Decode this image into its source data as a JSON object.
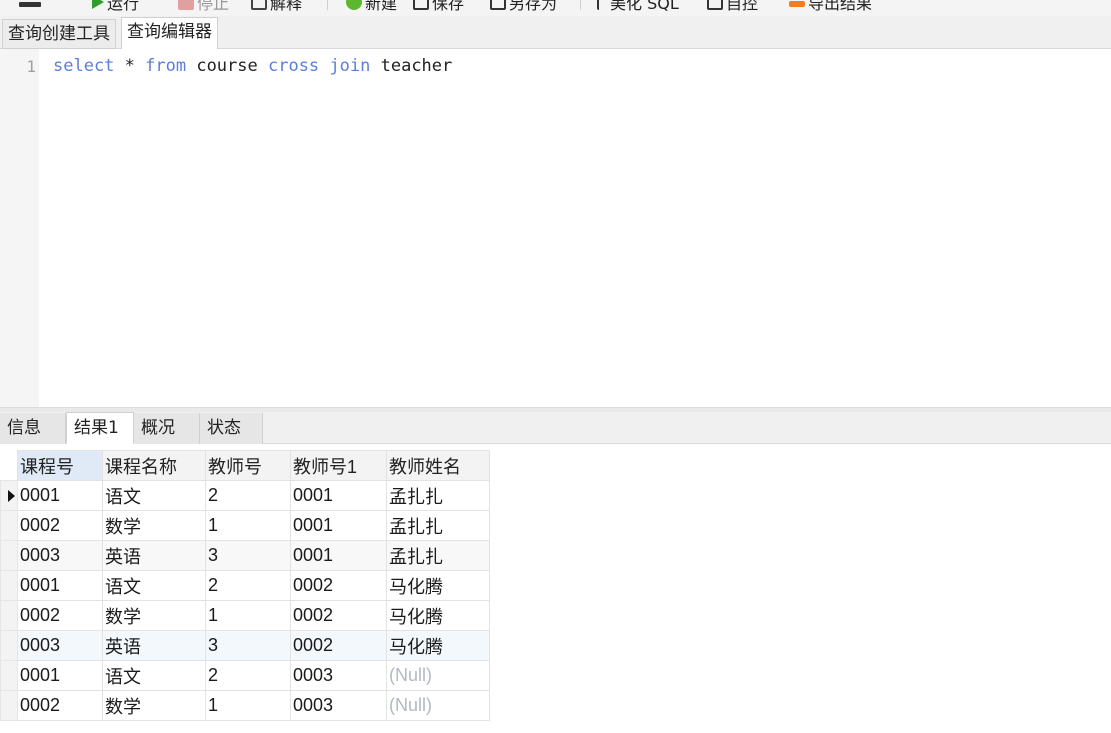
{
  "toolbar": {
    "run_label": "运行",
    "stop_label": "停止",
    "explain_label": "解释",
    "new_label": "新建",
    "save_label": "保存",
    "save_as_label": "另存为",
    "beautify_label": "美化 SQL",
    "snippet_label": "自控",
    "export_label": "导出结果"
  },
  "top_tabs": [
    "查询创建工具",
    "查询编辑器"
  ],
  "editor": {
    "line_number": "1",
    "tokens": [
      {
        "text": "select",
        "type": "keyword"
      },
      {
        "text": " * ",
        "type": "ident"
      },
      {
        "text": "from",
        "type": "keyword"
      },
      {
        "text": " course ",
        "type": "ident"
      },
      {
        "text": "cross",
        "type": "keyword"
      },
      {
        "text": " ",
        "type": "ident"
      },
      {
        "text": "join",
        "type": "keyword"
      },
      {
        "text": " teacher",
        "type": "ident"
      }
    ]
  },
  "bottom_tabs": [
    "信息",
    "结果1",
    "概况",
    "状态"
  ],
  "result": {
    "columns": [
      "课程号",
      "课程名称",
      "教师号",
      "教师号1",
      "教师姓名"
    ],
    "rows": [
      [
        "0001",
        "语文",
        "2",
        "0001",
        "孟扎扎"
      ],
      [
        "0002",
        "数学",
        "1",
        "0001",
        "孟扎扎"
      ],
      [
        "0003",
        "英语",
        "3",
        "0001",
        "孟扎扎"
      ],
      [
        "0001",
        "语文",
        "2",
        "0002",
        "马化腾"
      ],
      [
        "0002",
        "数学",
        "1",
        "0002",
        "马化腾"
      ],
      [
        "0003",
        "英语",
        "3",
        "0002",
        "马化腾"
      ],
      [
        "0001",
        "语文",
        "2",
        "0003",
        "(Null)"
      ],
      [
        "0002",
        "数学",
        "1",
        "0003",
        "(Null)"
      ]
    ]
  },
  "colors": {
    "keyword": "#5b7fd6",
    "null_text": "#b3b8c4",
    "selected_header": "#dfeaf6"
  }
}
